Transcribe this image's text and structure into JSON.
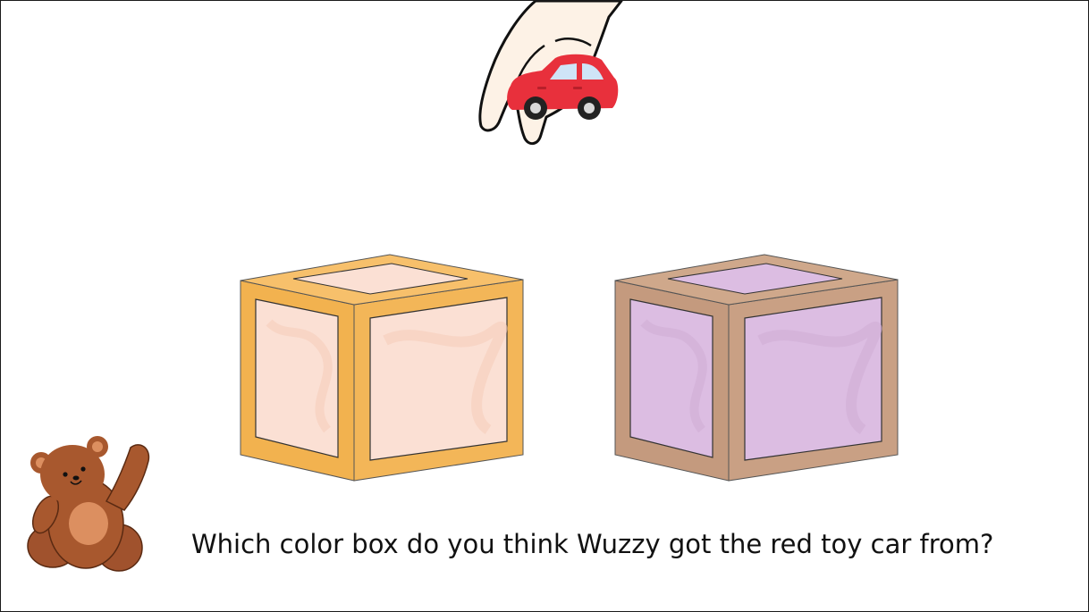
{
  "question": "Which color box do you think Wuzzy got the red toy car from?",
  "scene": {
    "hand_icon": "hand-holding-icon",
    "car_icon": "red-toy-car-icon",
    "bear_icon": "teddy-bear-icon",
    "boxes": [
      {
        "name": "orange",
        "frame_color": "#f2b24f",
        "panel_color": "#fbe0d4"
      },
      {
        "name": "brown",
        "frame_color": "#c49a7e",
        "panel_color": "#dcbde2"
      }
    ],
    "car_color": "#e8303c"
  }
}
